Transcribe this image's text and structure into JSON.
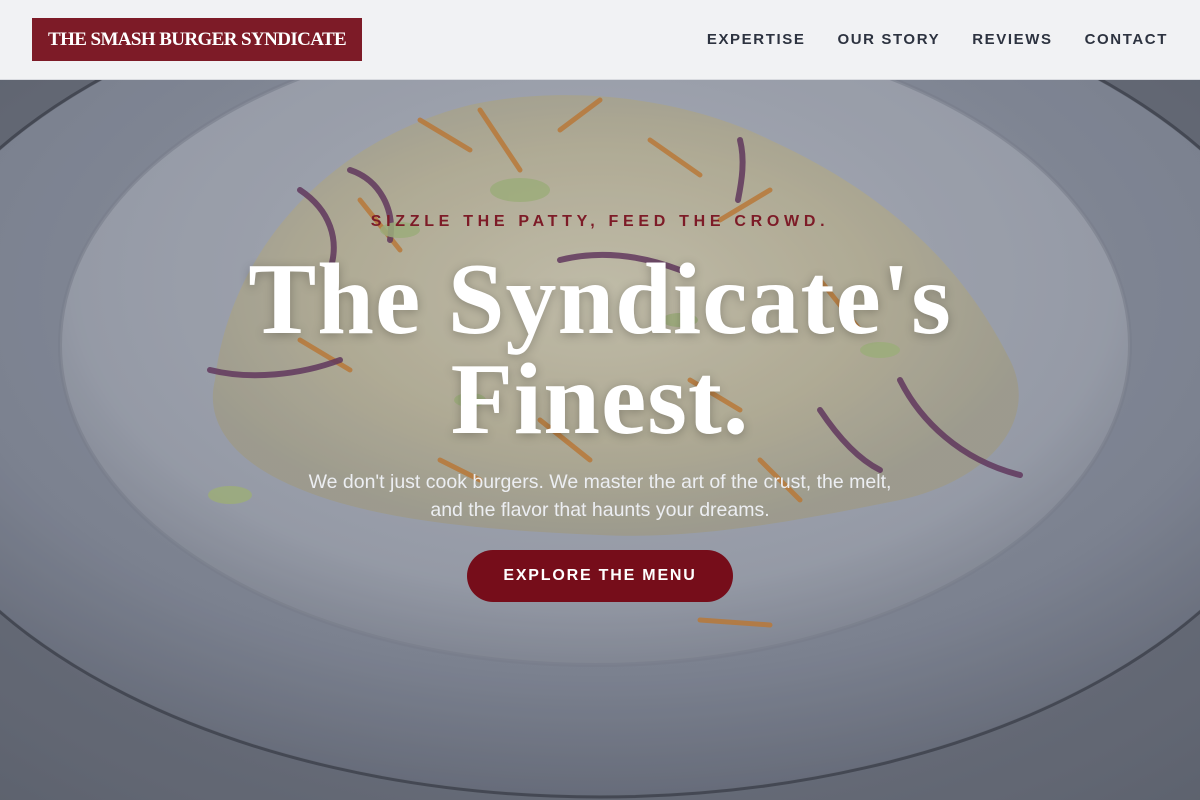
{
  "header": {
    "logo_text": "THE SMASH BURGER SYNDICATE",
    "nav": [
      {
        "label": "EXPERTISE"
      },
      {
        "label": "OUR STORY"
      },
      {
        "label": "REVIEWS"
      },
      {
        "label": "CONTACT"
      }
    ]
  },
  "hero": {
    "background": "coleslaw-plate-photo",
    "tagline": "SIZZLE THE PATTY, FEED THE CROWD.",
    "headline_line1": "The Syndicate's",
    "headline_line2": "Finest.",
    "subtext_line1": "We don't just cook burgers. We master the art of the crust, the melt,",
    "subtext_line2": "and the flavor that haunts your dreams.",
    "cta_label": "EXPLORE THE MENU"
  },
  "colors": {
    "brand": "#7d1b27",
    "cta": "#760d1a",
    "header_bg": "#f1f2f4",
    "nav_text": "#2d3340"
  }
}
